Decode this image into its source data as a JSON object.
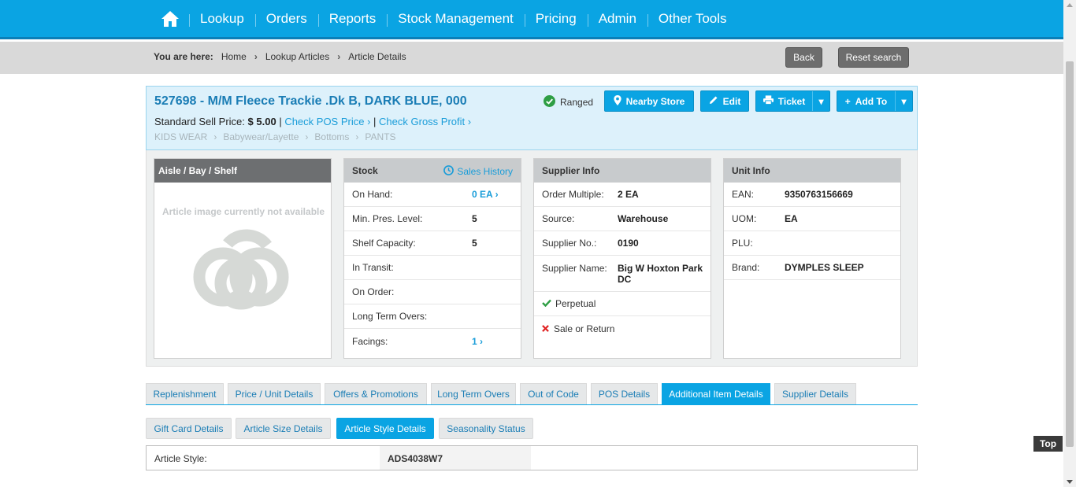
{
  "nav": {
    "items": [
      "Lookup",
      "Orders",
      "Reports",
      "Stock Management",
      "Pricing",
      "Admin",
      "Other Tools"
    ]
  },
  "breadcrumb": {
    "lead": "You are here:",
    "items": [
      "Home",
      "Lookup Articles",
      "Article Details"
    ]
  },
  "actions": {
    "back": "Back",
    "reset": "Reset search"
  },
  "article": {
    "title": "527698 - M/M Fleece Trackie .Dk B, DARK BLUE, 000",
    "price_label": "Standard Sell Price:",
    "price_value": "$ 5.00",
    "check_pos": "Check POS Price",
    "check_gross": "Check Gross Profit",
    "category": [
      "KIDS WEAR",
      "Babywear/Layette",
      "Bottoms",
      "PANTS"
    ],
    "ranged": "Ranged",
    "buttons": {
      "nearby": "Nearby Store",
      "edit": "Edit",
      "ticket": "Ticket",
      "add_to": "Add To"
    }
  },
  "aisle": {
    "header": "Aisle / Bay / Shelf",
    "no_image": "Article image currently not available"
  },
  "stock": {
    "header": "Stock",
    "sales_history": "Sales History",
    "rows": [
      {
        "label": "On Hand:",
        "value": "0 EA"
      },
      {
        "label": "Min. Pres. Level:",
        "value": "5"
      },
      {
        "label": "Shelf Capacity:",
        "value": "5"
      },
      {
        "label": "In Transit:",
        "value": ""
      },
      {
        "label": "On Order:",
        "value": ""
      },
      {
        "label": "Long Term Overs:",
        "value": ""
      },
      {
        "label": "Facings:",
        "value": "1"
      }
    ]
  },
  "supplier": {
    "header": "Supplier Info",
    "rows": [
      {
        "label": "Order Multiple:",
        "value": "2 EA"
      },
      {
        "label": "Source:",
        "value": "Warehouse"
      },
      {
        "label": "Supplier No.:",
        "value": "0190"
      },
      {
        "label": "Supplier Name:",
        "value": "Big W Hoxton Park DC"
      }
    ],
    "perpetual": "Perpetual",
    "sale_or_return": "Sale or Return"
  },
  "unit": {
    "header": "Unit Info",
    "rows": [
      {
        "label": "EAN:",
        "value": "9350763156669"
      },
      {
        "label": "UOM:",
        "value": "EA"
      },
      {
        "label": "PLU:",
        "value": ""
      },
      {
        "label": "Brand:",
        "value": "DYMPLES SLEEP"
      }
    ]
  },
  "tabs": [
    "Replenishment",
    "Price / Unit Details",
    "Offers & Promotions",
    "Long Term Overs",
    "Out of Code",
    "POS Details",
    "Additional Item Details",
    "Supplier Details"
  ],
  "subtabs": [
    "Gift Card Details",
    "Article Size Details",
    "Article Style Details",
    "Seasonality Status"
  ],
  "article_style": {
    "label": "Article Style:",
    "value": "ADS4038W7"
  },
  "top_button": "Top",
  "colors": {
    "primary": "#0aa4e3",
    "link": "#1a9dd9",
    "title": "#1a7db5"
  }
}
